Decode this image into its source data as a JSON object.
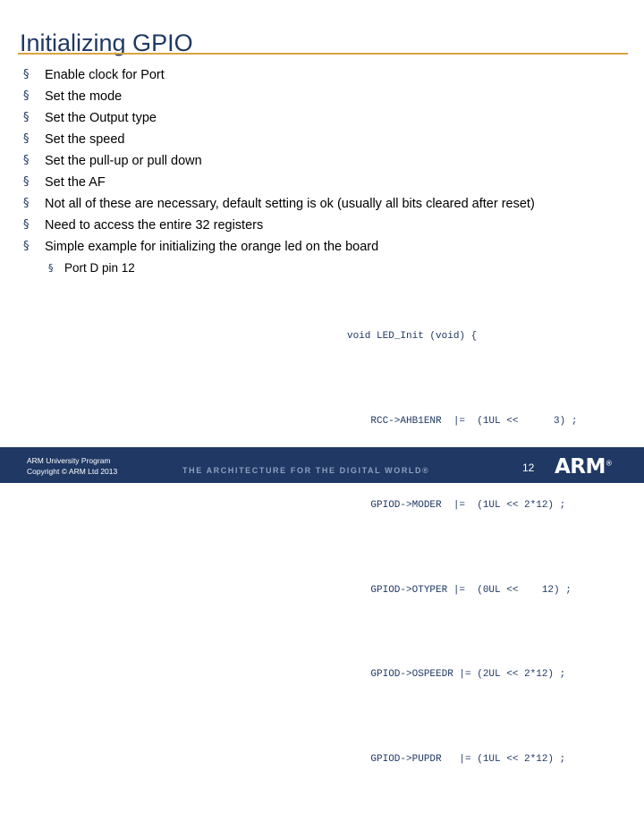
{
  "slide": {
    "title": "Initializing GPIO",
    "bullet_glyph": "§",
    "sub_bullet_glyph": "§",
    "bullets": [
      {
        "text": "Enable clock for Port",
        "level": 1
      },
      {
        "text": "Set the mode",
        "level": 1
      },
      {
        "text": "Set the Output type",
        "level": 1
      },
      {
        "text": "Set the speed",
        "level": 1
      },
      {
        "text": "Set the pull-up or pull down",
        "level": 1
      },
      {
        "text": "Set the AF",
        "level": 1
      },
      {
        "text": "Not all of these are necessary, default setting is ok (usually all bits cleared after reset)",
        "level": 1
      },
      {
        "text": "Need to access the entire 32 registers",
        "level": 1
      },
      {
        "text": "Simple example for initializing the orange led on the board",
        "level": 1
      },
      {
        "text": "Port D pin 12",
        "level": 2
      }
    ],
    "code": {
      "lines": [
        "void LED_Init (void) {",
        "    RCC->AHB1ENR  |=  (1UL <<      3) ;",
        "    GPIOD->MODER  |=  (1UL << 2*12) ;",
        "    GPIOD->OTYPER |=  (0UL <<    12) ;",
        "    GPIOD->OSPEEDR |= (2UL << 2*12) ;",
        "    GPIOD->PUPDR   |= (1UL << 2*12) ;"
      ]
    },
    "footer": {
      "line1": "ARM University Program",
      "line2": "Copyright © ARM Ltd 2013",
      "tagline": "THE ARCHITECTURE FOR THE DIGITAL WORLD®",
      "page_number": "12",
      "logo": "ARM",
      "logo_tm": "®"
    },
    "colors": {
      "title": "#1F3864",
      "rule": "#D9A441",
      "footer_bar": "#1F3864",
      "code_text": "#1F3864",
      "code_keyword": "#0000CC"
    }
  }
}
